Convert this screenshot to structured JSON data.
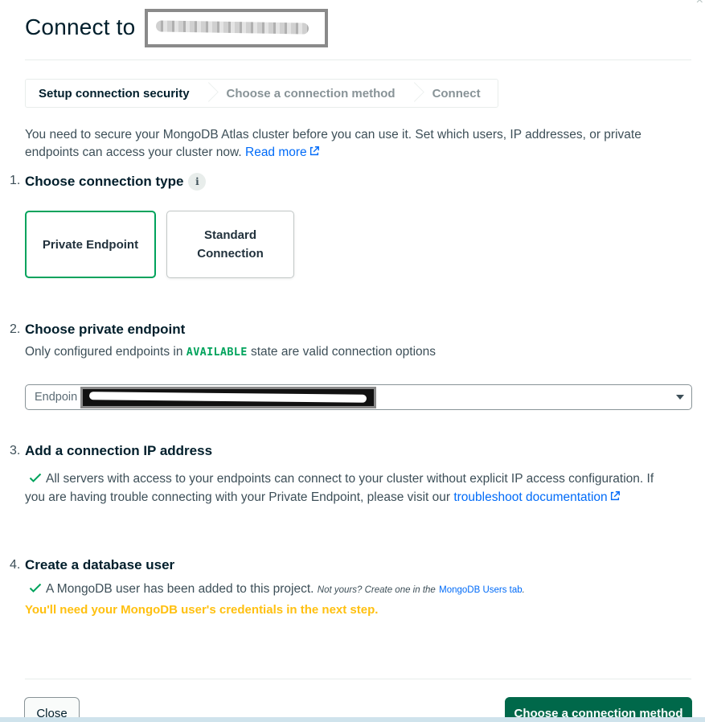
{
  "modal": {
    "title": "Connect to",
    "close_glyph": "×"
  },
  "stepper": {
    "steps": [
      {
        "label": "Setup connection security"
      },
      {
        "label": "Choose a connection method"
      },
      {
        "label": "Connect"
      }
    ]
  },
  "intro": {
    "text": "You need to secure your MongoDB Atlas cluster before you can use it. Set which users, IP addresses, or private endpoints can access your cluster now.",
    "read_more": "Read more"
  },
  "sections": [
    {
      "number": "1.",
      "title": "Choose connection type"
    },
    {
      "number": "2.",
      "title": "Choose private endpoint"
    },
    {
      "number": "3.",
      "title": "Add a connection IP address"
    },
    {
      "number": "4.",
      "title": "Create a database user"
    }
  ],
  "connection_types": {
    "selected": "Private Endpoint",
    "other": "Standard Connection"
  },
  "endpoint": {
    "helper_before": "Only configured endpoints in",
    "helper_badge": "AVAILABLE",
    "helper_after": "state are valid connection options",
    "select_value": "Endpoin"
  },
  "ip_section": {
    "text": "All servers with access to your endpoints can connect to your cluster without explicit IP access configuration. If you are having trouble connecting with your Private Endpoint, please visit our",
    "link": "troubleshoot documentation"
  },
  "user_section": {
    "text": "A MongoDB user has been added to this project.",
    "note_before": "Not yours? Create one in the",
    "note_link": "MongoDB Users tab",
    "note_after": ".",
    "warning": "You'll need your MongoDB user's credentials in the next step."
  },
  "footer": {
    "close_label": "Close",
    "primary_label": "Choose a connection method"
  },
  "colors": {
    "accent_green": "#00a35c",
    "primary_button": "#00684a",
    "link": "#016bf8",
    "warning": "#ffc010"
  },
  "icons": {
    "info": "info-icon",
    "external": "external-link-icon",
    "check": "check-icon",
    "caret": "caret-down-icon"
  }
}
